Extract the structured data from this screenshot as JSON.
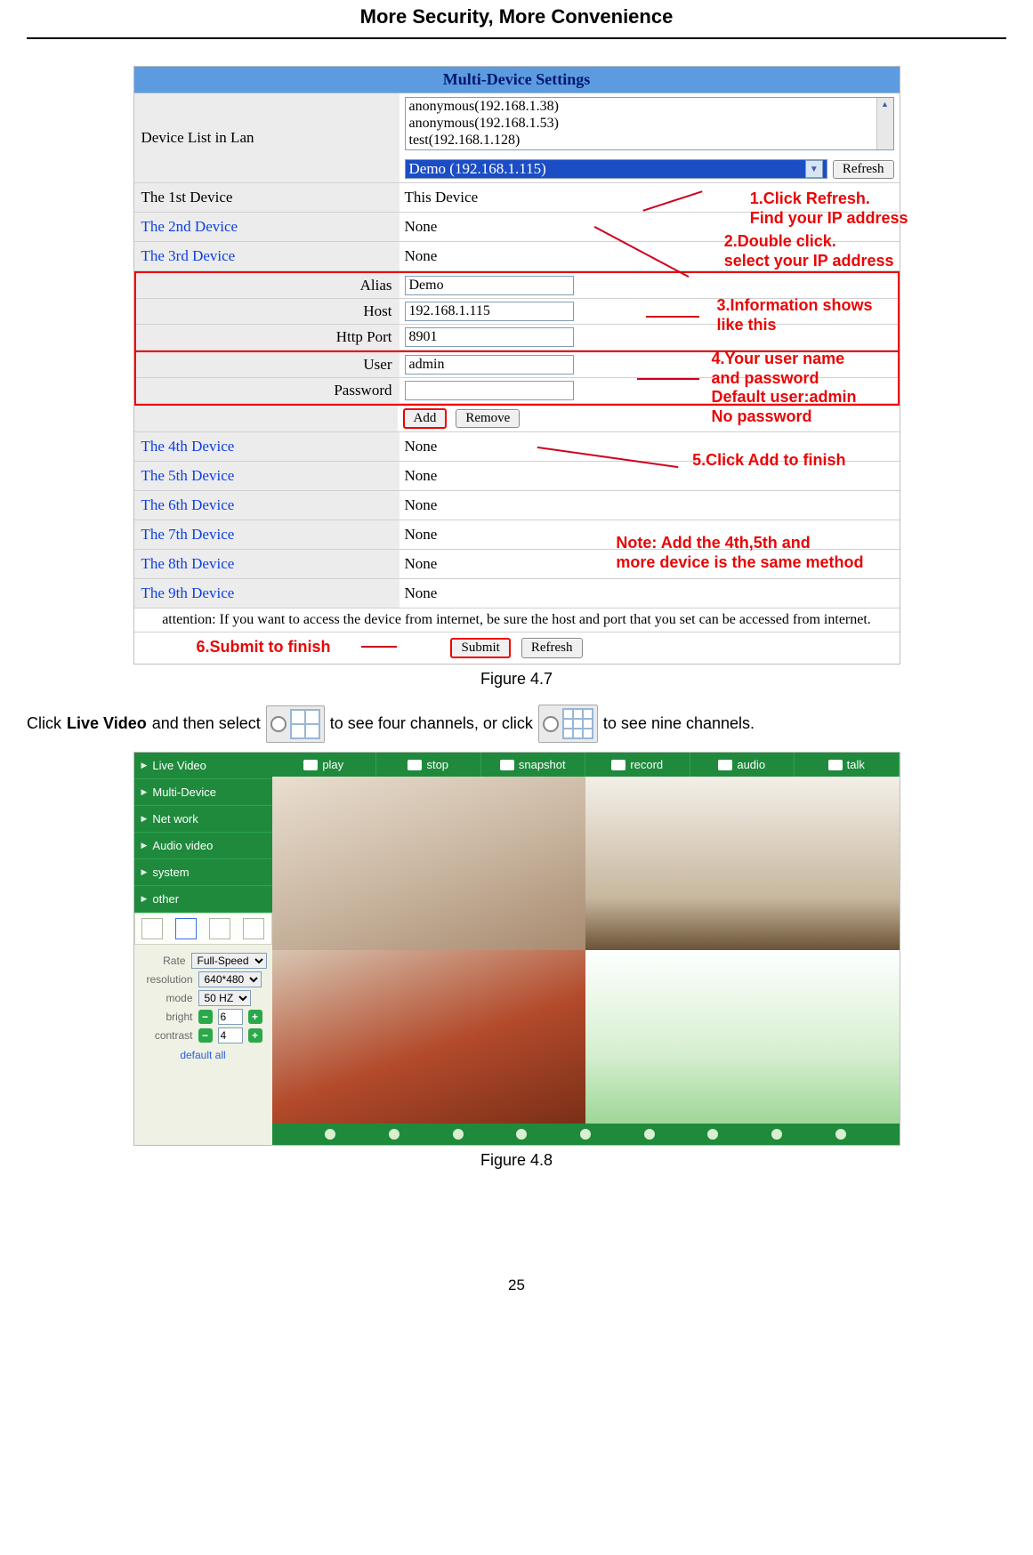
{
  "doc": {
    "header": "More Security, More Convenience",
    "page_number": "25",
    "fig47_caption": "Figure 4.7",
    "fig48_caption": "Figure 4.8",
    "instr_prefix": "Click ",
    "instr_bold": "Live Video",
    "instr_mid1": " and then select ",
    "instr_mid2": " to see four channels, or click ",
    "instr_end": " to see nine channels."
  },
  "multi": {
    "title": "Multi-Device Settings",
    "lan_label": "Device List in Lan",
    "listbox": {
      "items": [
        "anonymous(192.168.1.38)",
        "anonymous(192.168.1.53)",
        "test(192.168.1.128)"
      ]
    },
    "dropdown_selected": "Demo (192.168.1.115)",
    "refresh_btn": "Refresh",
    "devices": {
      "d1_label": "The 1st Device",
      "d1_val": "This Device",
      "d2_label": "The 2nd Device",
      "d2_val": "None",
      "d3_label": "The 3rd Device",
      "d3_val": "None",
      "d4_label": "The 4th Device",
      "d4_val": "None",
      "d5_label": "The 5th Device",
      "d5_val": "None",
      "d6_label": "The 6th Device",
      "d6_val": "None",
      "d7_label": "The 7th Device",
      "d7_val": "None",
      "d8_label": "The 8th Device",
      "d8_val": "None",
      "d9_label": "The 9th Device",
      "d9_val": "None"
    },
    "fields": {
      "alias_label": "Alias",
      "alias_val": "Demo",
      "host_label": "Host",
      "host_val": "192.168.1.115",
      "port_label": "Http Port",
      "port_val": "8901",
      "user_label": "User",
      "user_val": "admin",
      "pass_label": "Password",
      "pass_val": ""
    },
    "add_btn": "Add",
    "remove_btn": "Remove",
    "attention": "attention: If you want to access the device from internet, be sure the host and port that you set can be accessed from internet.",
    "submit_btn": "Submit",
    "refresh2_btn": "Refresh"
  },
  "annotations": {
    "a1": "1.Click Refresh.\nFind your IP address",
    "a2": "2.Double click.\nselect your IP address",
    "a3": "3.Information shows\nlike this",
    "a4": "4.Your user name\nand password\nDefault user:admin\nNo password",
    "a5": "5.Click Add to finish",
    "a6": "6.Submit to finish",
    "note": "Note: Add the 4th,5th and\nmore device is the same method"
  },
  "live": {
    "nav": [
      "Live Video",
      "Multi-Device",
      "Net work",
      "Audio video",
      "system",
      "other"
    ],
    "toolbar": [
      "play",
      "stop",
      "snapshot",
      "record",
      "audio",
      "talk"
    ],
    "controls": {
      "rate_label": "Rate",
      "rate_val": "Full-Speed",
      "res_label": "resolution",
      "res_val": "640*480",
      "mode_label": "mode",
      "mode_val": "50 HZ",
      "bright_label": "bright",
      "bright_val": "6",
      "contrast_label": "contrast",
      "contrast_val": "4",
      "default_all": "default all"
    }
  }
}
